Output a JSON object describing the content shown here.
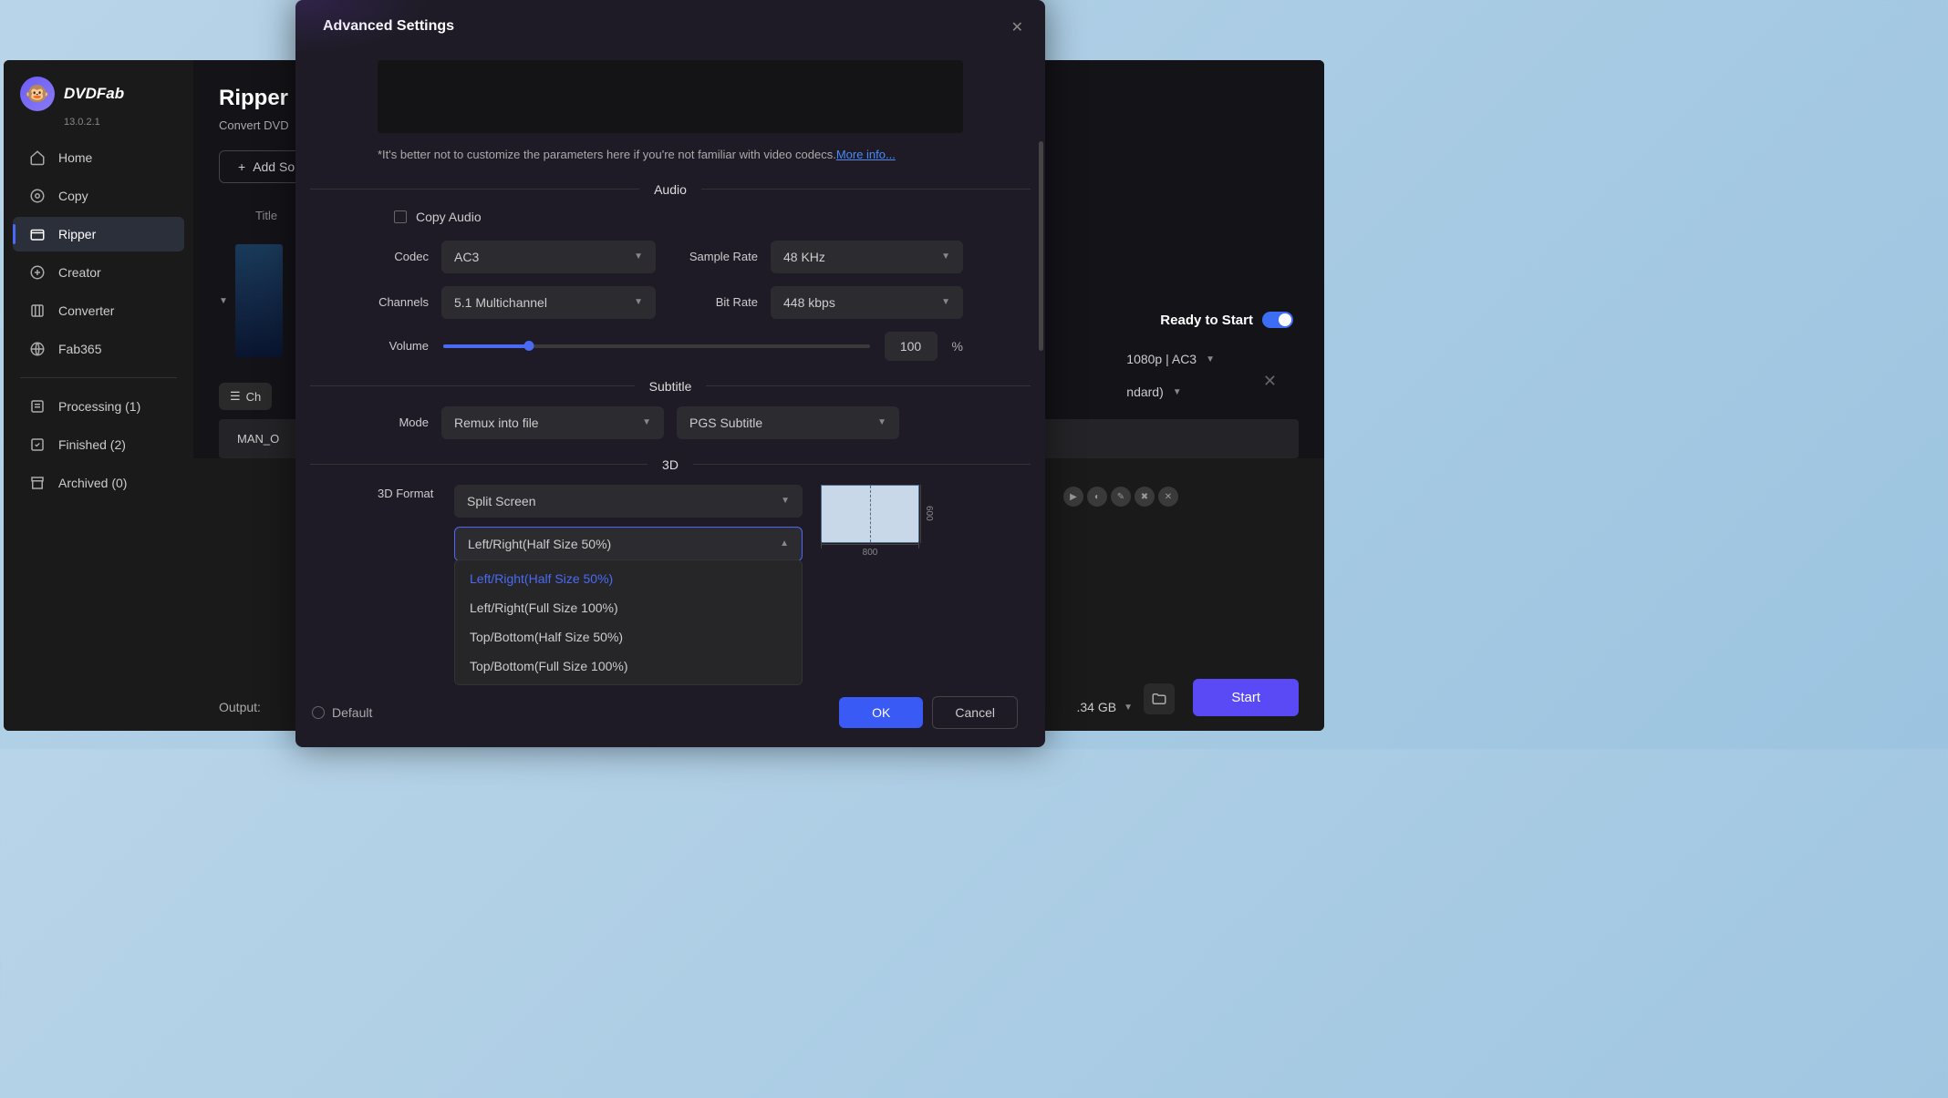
{
  "brand": "DVDFab",
  "version": "13.0.2.1",
  "nav": {
    "home": "Home",
    "copy": "Copy",
    "ripper": "Ripper",
    "creator": "Creator",
    "converter": "Converter",
    "fab365": "Fab365",
    "processing": "Processing (1)",
    "finished": "Finished (2)",
    "archived": "Archived (0)"
  },
  "page": {
    "title": "Ripper",
    "subtitle": "Convert DVD",
    "addSource": "Add So",
    "titleCol": "Title",
    "chooseOther": "Ch",
    "fileName": "MAN_O"
  },
  "output": {
    "label": "Output:"
  },
  "right": {
    "ready": "Ready to Start",
    "format": "1080p | AC3",
    "ndard": "ndard)",
    "size": ".34 GB",
    "start": "Start"
  },
  "modal": {
    "title": "Advanced Settings",
    "hint": "*It's better not to customize the parameters here if you're not familiar with video codecs.",
    "moreInfo": "More info...",
    "audioSec": "Audio",
    "copyAudio": "Copy Audio",
    "codecLabel": "Codec",
    "codec": "AC3",
    "sampleRateLabel": "Sample Rate",
    "sampleRate": "48 KHz",
    "channelsLabel": "Channels",
    "channels": "5.1 Multichannel",
    "bitRateLabel": "Bit Rate",
    "bitRate": "448 kbps",
    "volumeLabel": "Volume",
    "volume": "100",
    "pct": "%",
    "subtitleSec": "Subtitle",
    "modeLabel": "Mode",
    "mode": "Remux into file",
    "subType": "PGS Subtitle",
    "threeDSec": "3D",
    "d3Label": "3D Format",
    "splitScreen": "Split Screen",
    "d3Sel": "Left/Right(Half Size 50%)",
    "dd1": "Left/Right(Half Size 50%)",
    "dd2": "Left/Right(Full Size 100%)",
    "dd3": "Top/Bottom(Half Size 50%)",
    "dd4": "Top/Bottom(Full Size 100%)",
    "diagW": "800",
    "diagH": "600",
    "default": "Default",
    "ok": "OK",
    "cancel": "Cancel"
  }
}
